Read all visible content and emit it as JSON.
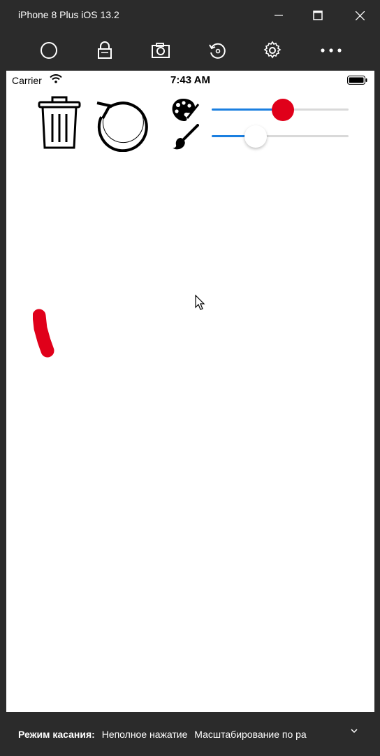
{
  "window": {
    "title": "iPhone 8 Plus iOS 13.2",
    "controls": {
      "minimize": "minimize-icon",
      "maximize": "maximize-icon",
      "close": "close-icon"
    }
  },
  "toolbar": {
    "items": [
      {
        "icon": "home-circle-icon"
      },
      {
        "icon": "lock-icon"
      },
      {
        "icon": "camera-icon"
      },
      {
        "icon": "rotate-icon"
      },
      {
        "icon": "gear-icon"
      },
      {
        "icon": "more-icon"
      }
    ]
  },
  "status": {
    "carrier": "Carrier",
    "time": "7:43 AM"
  },
  "app": {
    "icons": [
      "trash-icon",
      "undo-icon",
      "palette-icon",
      "brush-icon"
    ],
    "color_slider": {
      "value": 0.52,
      "thumb_color": "#e0001a",
      "fill_color": "#1b7fe0"
    },
    "width_slider": {
      "value": 0.32,
      "thumb_color": "#ffffff",
      "fill_color": "#1b7fe0"
    },
    "stroke_color": "#e0001a"
  },
  "bottom": {
    "label": "Режим касания:",
    "options": [
      "Неполное нажатие",
      "Масштабирование по ра"
    ]
  }
}
